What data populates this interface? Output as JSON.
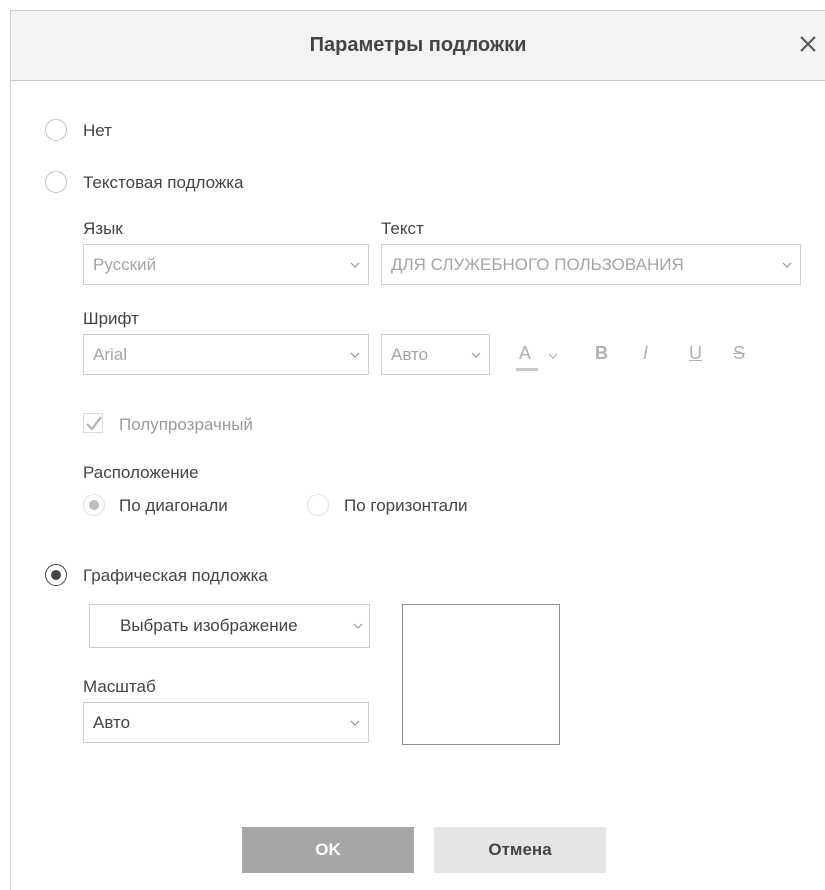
{
  "dialog": {
    "title": "Параметры подложки"
  },
  "options": {
    "none": "Нет",
    "text_watermark": "Текстовая подложка",
    "image_watermark": "Графическая подложка"
  },
  "text_settings": {
    "language_label": "Язык",
    "language_value": "Русский",
    "text_label": "Текст",
    "text_value": "ДЛЯ СЛУЖЕБНОГО ПОЛЬЗОВАНИЯ",
    "font_label": "Шрифт",
    "font_value": "Arial",
    "size_value": "Авто",
    "color_btn": "A",
    "bold_btn": "B",
    "italic_btn": "I",
    "underline_btn": "U",
    "strike_btn": "S",
    "semitransparent_label": "Полупрозрачный",
    "semitransparent_checked": true,
    "layout_label": "Расположение",
    "diagonal_label": "По диагонали",
    "horizontal_label": "По горизонтали"
  },
  "image_settings": {
    "select_image_label": "Выбрать изображение",
    "scale_label": "Масштаб",
    "scale_value": "Авто"
  },
  "buttons": {
    "ok": "OK",
    "cancel": "Отмена"
  },
  "selected_option": "image_watermark",
  "selected_layout": "diagonal"
}
